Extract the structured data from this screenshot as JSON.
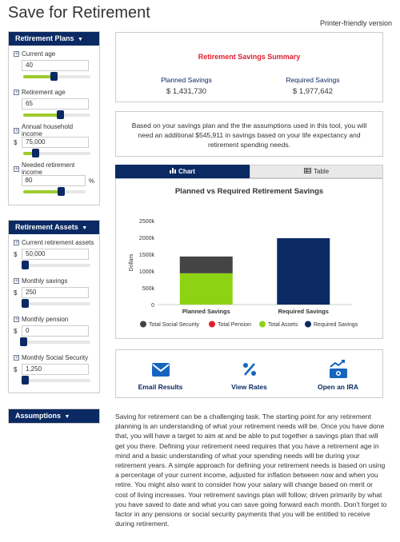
{
  "page": {
    "title": "Save for Retirement",
    "printer_link": "Printer-friendly version"
  },
  "sidebar": {
    "plans": {
      "header": "Retirement Plans",
      "fields": [
        {
          "label": "Current age",
          "value": "40",
          "prefix": "",
          "suffix": "",
          "slider": 0.45
        },
        {
          "label": "Retirement age",
          "value": "65",
          "prefix": "",
          "suffix": "",
          "slider": 0.55
        },
        {
          "label": "Annual household income",
          "value": "75,000",
          "prefix": "$",
          "suffix": "",
          "slider": 0.18
        },
        {
          "label": "Needed retirement income",
          "value": "80",
          "prefix": "",
          "suffix": "%",
          "slider": 0.6
        }
      ]
    },
    "assets": {
      "header": "Retirement Assets",
      "fields": [
        {
          "label": "Current retirement assets",
          "value": "50,000",
          "prefix": "$",
          "suffix": "",
          "slider": 0.02
        },
        {
          "label": "Monthly savings",
          "value": "250",
          "prefix": "$",
          "suffix": "",
          "slider": 0.02
        },
        {
          "label": "Monthly pension",
          "value": "0",
          "prefix": "$",
          "suffix": "",
          "slider": 0.0
        },
        {
          "label": "Monthly Social Security",
          "value": "1,250",
          "prefix": "$",
          "suffix": "",
          "slider": 0.02
        }
      ]
    },
    "assumptions": {
      "header": "Assumptions"
    }
  },
  "summary": {
    "title": "Retirement Savings Summary",
    "planned_label": "Planned Savings",
    "planned_value": "$ 1,431,730",
    "required_label": "Required Savings",
    "required_value": "$ 1,977,642"
  },
  "message": "Based on your savings plan and the the assumptions used in this tool, you will need an additional $545,911 in savings based on your life expectancy and retirement spending needs.",
  "tabs": {
    "chart": "Chart",
    "table": "Table"
  },
  "chart_data": {
    "type": "bar",
    "title": "Planned vs Required Retirement Savings",
    "ylabel": "Dollars",
    "ylim": [
      0,
      2500000
    ],
    "yticks": [
      0,
      500000,
      1000000,
      1500000,
      2000000,
      2500000
    ],
    "ytick_labels": [
      "0",
      "500k",
      "1000k",
      "1500k",
      "2000k",
      "2500k"
    ],
    "categories": [
      "Planned Savings",
      "Required Savings"
    ],
    "series": [
      {
        "name": "Total Social Security",
        "color": "#444444",
        "values": [
          500000,
          0
        ]
      },
      {
        "name": "Total Pension",
        "color": "#e0202d",
        "values": [
          0,
          0
        ]
      },
      {
        "name": "Total Assets",
        "color": "#8dd313",
        "values": [
          931730,
          0
        ]
      },
      {
        "name": "Required Savings",
        "color": "#0b2a63",
        "values": [
          0,
          1977642
        ]
      }
    ]
  },
  "actions": [
    {
      "label": "Email Results",
      "icon": "envelope-icon"
    },
    {
      "label": "View Rates",
      "icon": "percent-icon"
    },
    {
      "label": "Open an IRA",
      "icon": "money-growth-icon"
    }
  ],
  "article": "Saving for retirement can be a challenging task. The starting point for any retirement planning is an understanding of what your retirement needs will be. Once you have done that, you will have a target to aim at and be able to put together a savings plan that will get you there. Defining your retirement need requires that you have a retirement age in mind and a basic understanding of what your spending needs will be during your retirement years. A simple approach for defining your retirement needs is based on using a percentage of your current income, adjusted for inflation between now and when you retire. You might also want to consider how your salary will change based on merit or cost of living increases. Your retirement savings plan will follow; driven primarily by what you have saved to date and what you can save going forward each month. Don't forget to factor in any pensions or social security payments that you will be entitled to receive during retirement.",
  "colors": {
    "navy": "#0b2a63",
    "red": "#e0202d",
    "green": "#9ecb2d"
  }
}
